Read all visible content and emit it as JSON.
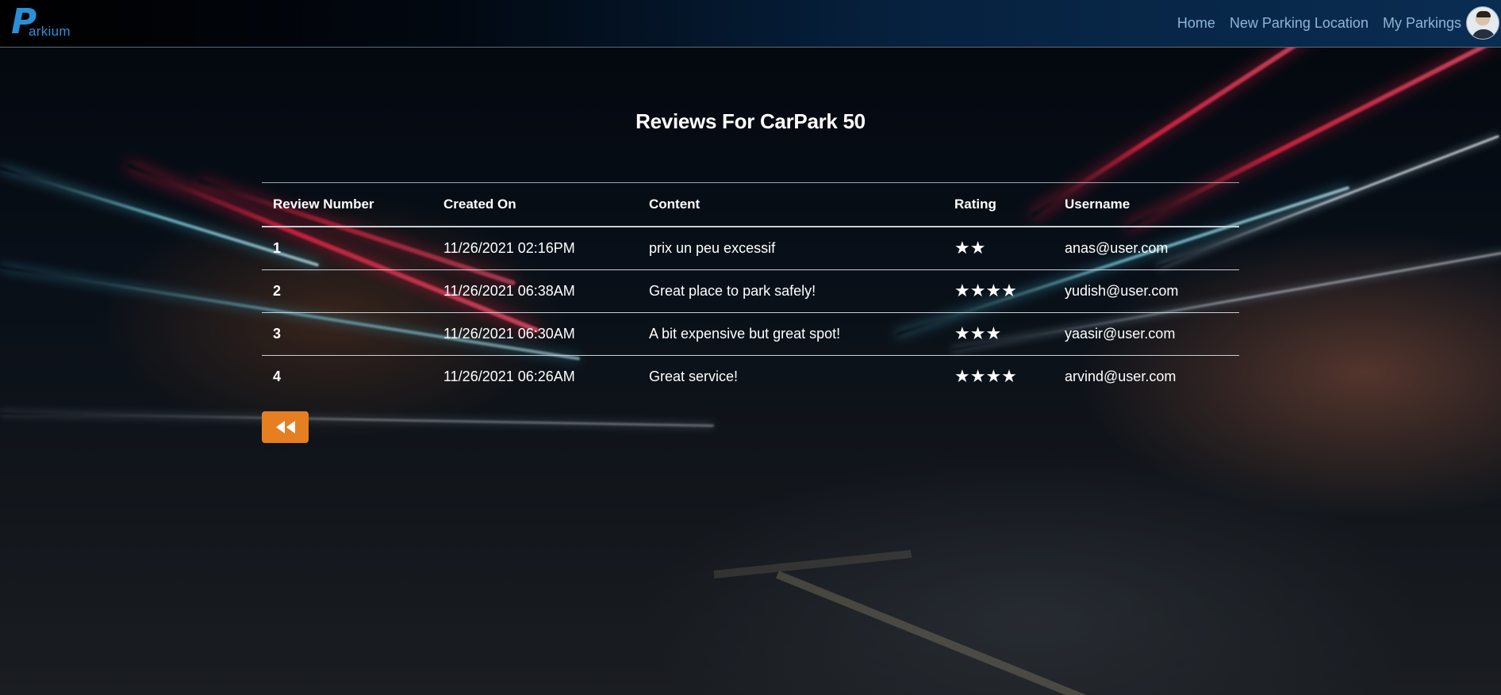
{
  "app": {
    "logo_text": "arkium",
    "logo_letter": "P"
  },
  "nav": {
    "items": [
      {
        "label": "Home"
      },
      {
        "label": "New Parking Location"
      },
      {
        "label": "My Parkings"
      }
    ],
    "avatar_icon": "user-avatar"
  },
  "page": {
    "title": "Reviews For CarPark 50"
  },
  "table": {
    "headers": [
      "Review Number",
      "Created On",
      "Content",
      "Rating",
      "Username"
    ],
    "rows": [
      {
        "number": "1",
        "created_on": "11/26/2021 02:16PM",
        "content": "prix un peu excessif",
        "rating": 2,
        "rating_stars": "★★",
        "username": "anas@user.com"
      },
      {
        "number": "2",
        "created_on": "11/26/2021 06:38AM",
        "content": "Great place to park safely!",
        "rating": 4,
        "rating_stars": "★★★★",
        "username": "yudish@user.com"
      },
      {
        "number": "3",
        "created_on": "11/26/2021 06:30AM",
        "content": "A bit expensive but great spot!",
        "rating": 3,
        "rating_stars": "★★★",
        "username": "yaasir@user.com"
      },
      {
        "number": "4",
        "created_on": "11/26/2021 06:26AM",
        "content": "Great service!",
        "rating": 4,
        "rating_stars": "★★★★",
        "username": "arvind@user.com"
      }
    ]
  },
  "back_button": {
    "icon": "fast-backward-icon"
  },
  "colors": {
    "accent": "#e67e22",
    "brand": "#2b8fd6",
    "nav_link": "#8fb4d6"
  }
}
